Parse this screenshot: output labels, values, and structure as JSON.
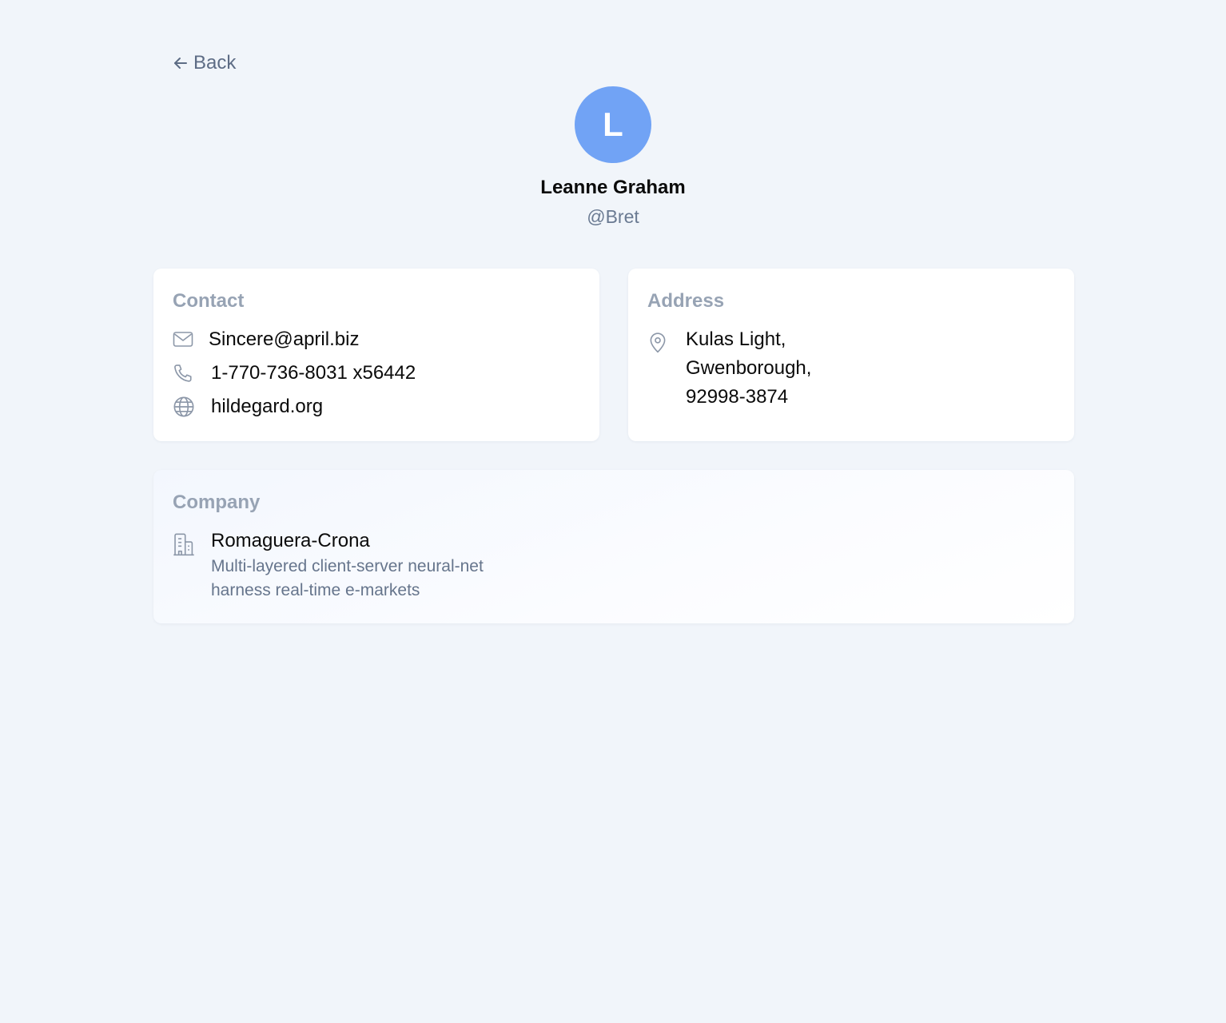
{
  "nav": {
    "back_label": "Back"
  },
  "profile": {
    "initial": "L",
    "name": "Leanne Graham",
    "username": "@Bret",
    "avatar_color": "#71a3f5"
  },
  "contact": {
    "title": "Contact",
    "email": "Sincere@april.biz",
    "phone": "1-770-736-8031 x56442",
    "website": "hildegard.org",
    "icons": [
      "mail-icon",
      "phone-icon",
      "globe-icon"
    ]
  },
  "address": {
    "title": "Address",
    "lines": [
      "Kulas Light,",
      "Gwenborough,",
      "92998-3874"
    ],
    "icon": "map-pin-icon"
  },
  "company": {
    "title": "Company",
    "name": "Romaguera-Crona",
    "catch_phrase": "Multi-layered client-server neural-net",
    "bs": "harness real-time e-markets",
    "icon": "building-icon"
  },
  "colors": {
    "background": "#f1f5fa",
    "muted_text": "#6a7a92",
    "card_title": "#97a3b4",
    "icon_stroke": "#8c97a8"
  }
}
